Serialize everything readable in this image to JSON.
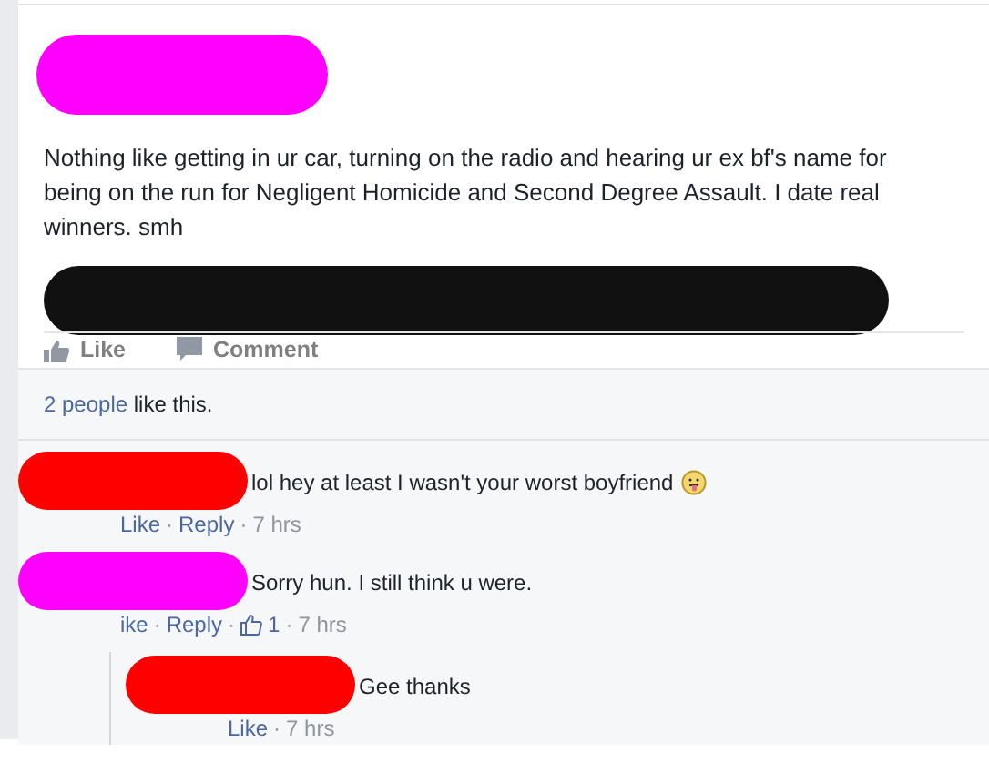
{
  "post": {
    "text": "Nothing like getting in ur car, turning on the radio and hearing ur ex bf's name for being on the run for Negligent Homicide and Second Degree Assault. I date real winners. smh"
  },
  "actions": [
    {
      "kind": "like",
      "label": "Like"
    },
    {
      "kind": "comment",
      "label": "Comment"
    }
  ],
  "likes": {
    "link": "2 people",
    "text": "like this."
  },
  "comments": [
    {
      "color": "#ff0000",
      "text": "lol hey at least I wasn't your worst boyfriend",
      "emoji": true,
      "meta": [
        {
          "kind": "like",
          "text": "Like"
        },
        {
          "kind": "sep",
          "text": "·"
        },
        {
          "kind": "reply",
          "text": "Reply"
        },
        {
          "kind": "sep",
          "text": "·"
        },
        {
          "kind": "time",
          "text": "7 hrs"
        }
      ]
    },
    {
      "color": "#ff00ff",
      "text": "Sorry hun. I still think u were.",
      "meta": [
        {
          "kind": "like",
          "text": "ike"
        },
        {
          "kind": "sep",
          "text": "·"
        },
        {
          "kind": "reply",
          "text": "Reply"
        },
        {
          "kind": "sep",
          "text": "·"
        },
        {
          "kind": "count",
          "text": "1"
        },
        {
          "kind": "sep",
          "text": "·"
        },
        {
          "kind": "time",
          "text": "7 hrs"
        }
      ],
      "replies": [
        {
          "color": "#ff0000",
          "text": "Gee thanks",
          "meta": [
            {
              "kind": "like",
              "text": "Like"
            },
            {
              "kind": "sep",
              "text": "·"
            },
            {
              "kind": "time",
              "text": "7 hrs"
            }
          ]
        }
      ]
    }
  ]
}
